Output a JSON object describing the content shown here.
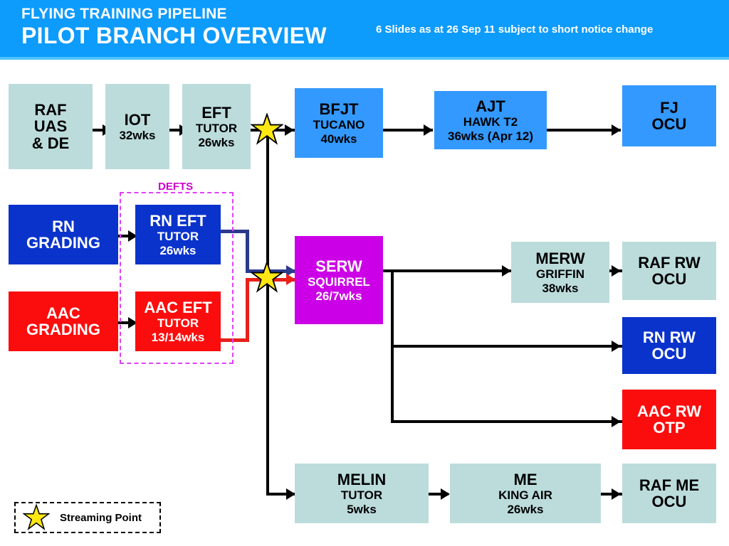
{
  "header": {
    "line1": "FLYING TRAINING PIPELINE",
    "line2": "PILOT BRANCH OVERVIEW",
    "note": "6 Slides as at 26 Sep 11 subject to short notice change",
    "bar_color": "#0d9bfc"
  },
  "legend": {
    "icon": "star-icon",
    "label": "Streaming Point"
  },
  "groups": {
    "defts": {
      "label": "DEFTS",
      "border_color": "#e040fb"
    }
  },
  "palette": {
    "pale": "#bcdcdc",
    "blue": "#3399ff",
    "navy": "#0a33cc",
    "red": "#fc0d0d",
    "magenta": "#cc00e6",
    "line_navy": "#2b3a8c",
    "line_red": "#e8211a"
  },
  "nodes": [
    {
      "id": "raf-uas-de",
      "t1": "RAF",
      "t2": "UAS",
      "t3": "& DE",
      "fill": "pale"
    },
    {
      "id": "iot",
      "t1": "IOT",
      "t2": "32wks",
      "t3": "",
      "fill": "pale"
    },
    {
      "id": "eft",
      "t1": "EFT",
      "t2": "TUTOR",
      "t3": "26wks",
      "fill": "pale"
    },
    {
      "id": "bfjt",
      "t1": "BFJT",
      "t2": "TUCANO",
      "t3": "40wks",
      "fill": "blue"
    },
    {
      "id": "ajt",
      "t1": "AJT",
      "t2": "HAWK T2",
      "t3": "36wks (Apr 12)",
      "fill": "blue"
    },
    {
      "id": "fj-ocu",
      "t1": "FJ",
      "t2": "OCU",
      "t3": "",
      "fill": "blue"
    },
    {
      "id": "rn-grading",
      "t1": "RN",
      "t2": "GRADING",
      "t3": "",
      "fill": "navy"
    },
    {
      "id": "rn-eft",
      "t1": "RN EFT",
      "t2": "TUTOR",
      "t3": "26wks",
      "fill": "navy"
    },
    {
      "id": "aac-grading",
      "t1": "AAC",
      "t2": "GRADING",
      "t3": "",
      "fill": "red"
    },
    {
      "id": "aac-eft",
      "t1": "AAC EFT",
      "t2": "TUTOR",
      "t3": "13/14wks",
      "fill": "red"
    },
    {
      "id": "serw",
      "t1": "SERW",
      "t2": "SQUIRREL",
      "t3": "26/7wks",
      "fill": "magenta"
    },
    {
      "id": "merw",
      "t1": "MERW",
      "t2": "GRIFFIN",
      "t3": "38wks",
      "fill": "pale"
    },
    {
      "id": "raf-rw-ocu",
      "t1": "RAF RW",
      "t2": "OCU",
      "t3": "",
      "fill": "pale"
    },
    {
      "id": "rn-rw-ocu",
      "t1": "RN RW",
      "t2": "OCU",
      "t3": "",
      "fill": "navy"
    },
    {
      "id": "aac-rw-otp",
      "t1": "AAC RW",
      "t2": "OTP",
      "t3": "",
      "fill": "red"
    },
    {
      "id": "melin",
      "t1": "MELIN",
      "t2": "TUTOR",
      "t3": "5wks",
      "fill": "pale"
    },
    {
      "id": "me",
      "t1": "ME",
      "t2": "KING AIR",
      "t3": "26wks",
      "fill": "pale"
    },
    {
      "id": "raf-me-ocu",
      "t1": "RAF ME",
      "t2": "OCU",
      "t3": "",
      "fill": "pale"
    }
  ],
  "streaming_points": [
    {
      "id": "streaming-point-fixed-wing"
    },
    {
      "id": "streaming-point-rotary-wing"
    }
  ]
}
